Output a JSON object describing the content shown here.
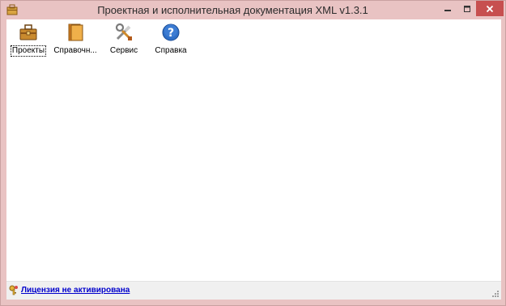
{
  "window": {
    "title": "Проектная и исполнительная документация XML v1.3.1",
    "frame_color": "#e9c3c3",
    "close_button_color": "#c74f4f"
  },
  "toolbar": {
    "items": [
      {
        "label": "Проекты",
        "icon": "briefcase-icon"
      },
      {
        "label": "Справочн...",
        "icon": "books-icon"
      },
      {
        "label": "Сервис",
        "icon": "tools-icon"
      },
      {
        "label": "Справка",
        "icon": "help-icon"
      }
    ]
  },
  "statusbar": {
    "license_text": "Лицензия не активирована",
    "license_icon": "key-icon",
    "link_color": "#0000cc"
  }
}
